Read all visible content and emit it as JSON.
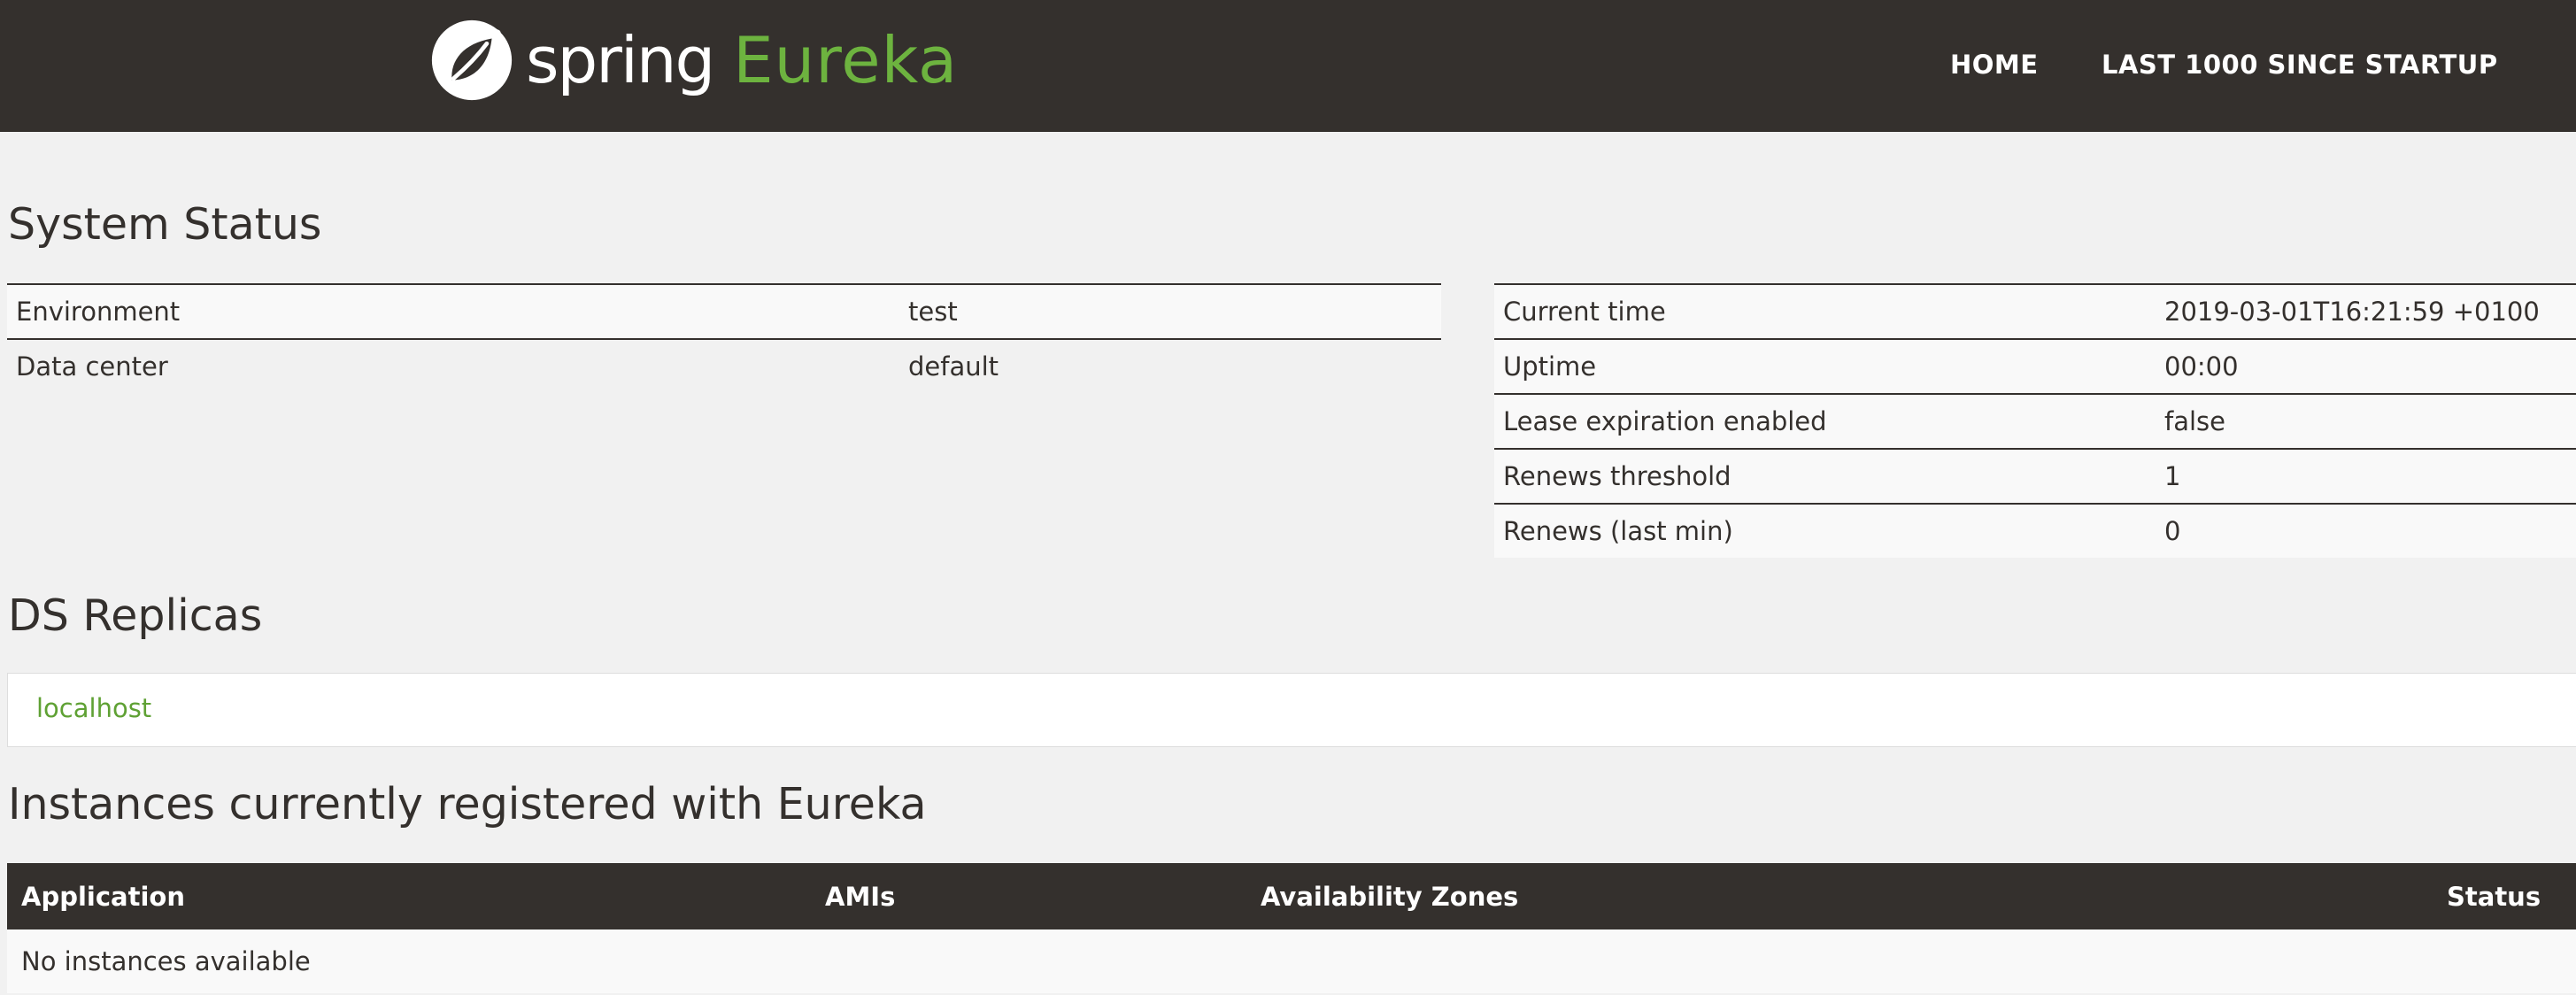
{
  "navbar": {
    "brand_spring": "spring",
    "brand_eureka": "Eureka",
    "links": {
      "home": "HOME",
      "last1000": "LAST 1000 SINCE STARTUP"
    }
  },
  "system_status": {
    "title": "System Status",
    "left_rows": [
      {
        "key": "Environment",
        "value": "test"
      },
      {
        "key": "Data center",
        "value": "default"
      }
    ],
    "right_rows": [
      {
        "key": "Current time",
        "value": "2019-03-01T16:21:59 +0100"
      },
      {
        "key": "Uptime",
        "value": "00:00"
      },
      {
        "key": "Lease expiration enabled",
        "value": "false"
      },
      {
        "key": "Renews threshold",
        "value": "1"
      },
      {
        "key": "Renews (last min)",
        "value": "0"
      }
    ]
  },
  "ds_replicas": {
    "title": "DS Replicas",
    "items": [
      "localhost"
    ]
  },
  "instances": {
    "title": "Instances currently registered with Eureka",
    "columns": [
      "Application",
      "AMIs",
      "Availability Zones",
      "Status"
    ],
    "empty_text": "No instances available"
  },
  "colors": {
    "navbar_bg": "#34302d",
    "page_bg": "#f1f1f1",
    "accent_green": "#6db33f",
    "link_green": "#5fa134"
  },
  "icons": {
    "logo": "spring-leaf-icon"
  }
}
